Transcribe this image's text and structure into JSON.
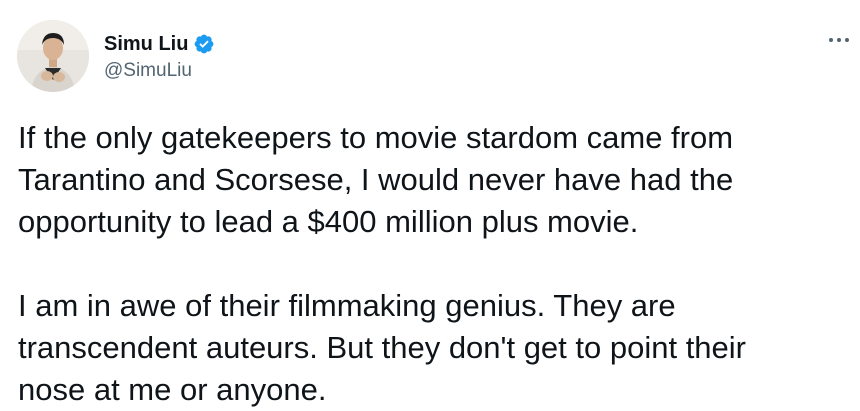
{
  "author": {
    "display_name": "Simu Liu",
    "handle": "@SimuLiu",
    "verified": true,
    "avatar_icon": "profile-photo",
    "verified_icon": "verified-badge-icon",
    "verified_color": "#1d9bf0"
  },
  "menu": {
    "icon": "more-options-icon"
  },
  "tweet": {
    "paragraph1": [
      "If the only gatekeepers to movie stardom came from",
      "Tarantino and Scorsese, I would never have had the",
      "opportunity to lead a $400 million plus movie."
    ],
    "paragraph2": [
      "I am in awe of their filmmaking genius. They are",
      "transcendent auteurs. But they don't get to point their",
      "nose at me or anyone."
    ]
  },
  "colors": {
    "text_primary": "#0f1419",
    "text_secondary": "#536471",
    "background": "#ffffff"
  }
}
